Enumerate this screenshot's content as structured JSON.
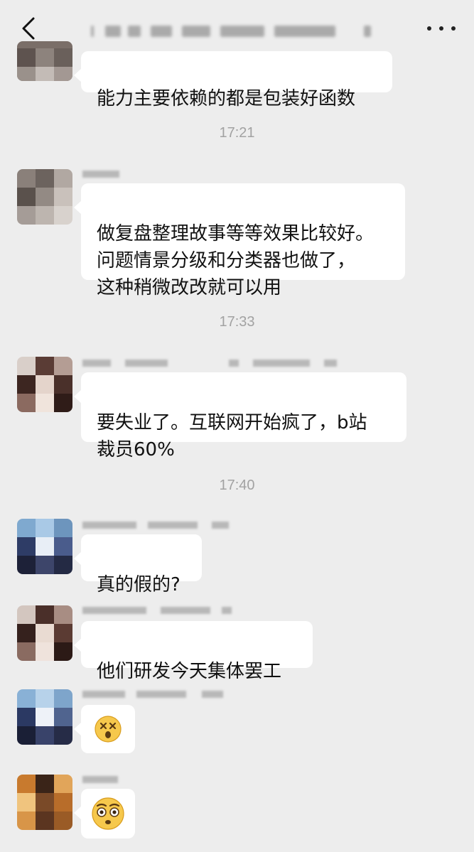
{
  "header": {
    "back_icon": "chevron-left-icon",
    "more_icon": "more-dots-icon"
  },
  "messages": [
    {
      "text": "能力主要依赖的都是包装好函数"
    },
    {
      "text": "做复盘整理故事等等效果比较好。\n问题情景分级和分类器也做了，\n这种稍微改改就可以用"
    },
    {
      "text": "要失业了。互联网开始疯了，b站\n裁员60%"
    },
    {
      "text": "真的假的?"
    },
    {
      "text": "他们研发今天集体罢工"
    },
    {
      "emoji": "dizzy-face-emoji"
    },
    {
      "emoji": "flushed-face-emoji"
    }
  ],
  "timestamps": [
    "17:21",
    "17:33",
    "17:40"
  ],
  "colors": {
    "background": "#ededed",
    "bubble": "#ffffff",
    "timestamp": "#a2a2a2"
  }
}
